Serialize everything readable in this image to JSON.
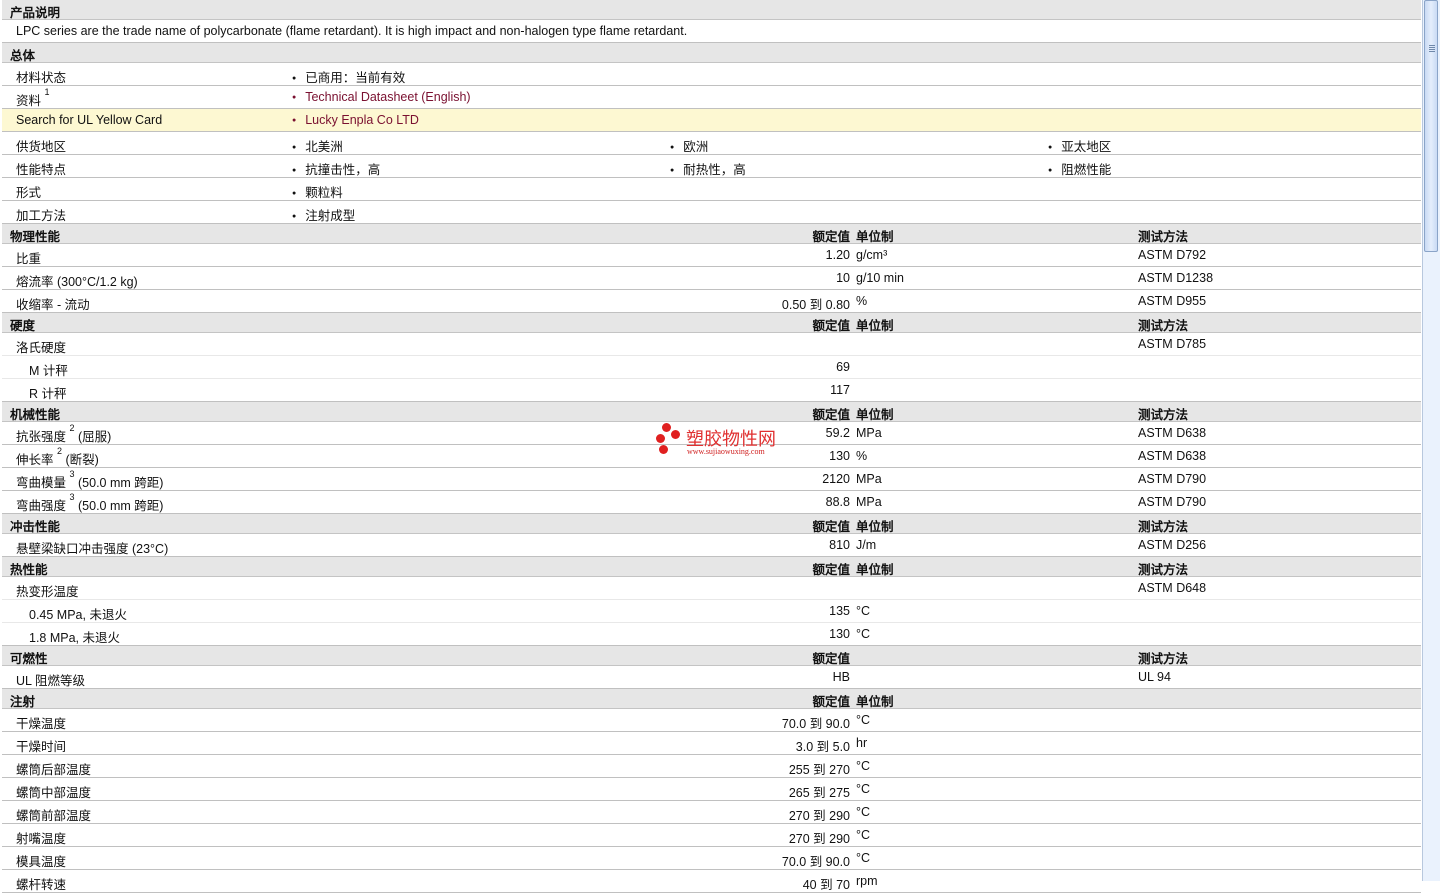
{
  "sections": [
    {
      "title": "产品说明",
      "rows": [
        {
          "type": "desc",
          "label": "LPC series are the trade name of polycarbonate (flame retardant). It is high impact and non-halogen type flame retardant."
        }
      ]
    },
    {
      "title": "总体",
      "rows": [
        {
          "type": "bullets",
          "label": "材料状态",
          "items": [
            "已商用：当前有效"
          ]
        },
        {
          "type": "bullets",
          "label": "资料",
          "sup": "1",
          "items": [
            "Technical Datasheet (English)"
          ],
          "link": true
        },
        {
          "type": "bullets",
          "label": "Search for UL Yellow Card",
          "items": [
            "Lucky Enpla Co LTD"
          ],
          "link": true,
          "yellow": true
        },
        {
          "type": "bullets",
          "label": "供货地区",
          "items": [
            "北美洲",
            "欧洲",
            "亚太地区"
          ]
        },
        {
          "type": "bullets",
          "label": "性能特点",
          "items": [
            "抗撞击性，高",
            "耐热性，高",
            "阻燃性能"
          ]
        },
        {
          "type": "bullets",
          "label": "形式",
          "items": [
            "颗粒料"
          ]
        },
        {
          "type": "bullets",
          "label": "加工方法",
          "items": [
            "注射成型"
          ]
        }
      ]
    },
    {
      "title": "物理性能",
      "h_val": "额定值",
      "h_unit": "单位制",
      "h_tm": "测试方法",
      "rows": [
        {
          "label": "比重",
          "value": "1.20",
          "unit": "g/cm³",
          "tm": "ASTM D792"
        },
        {
          "label": "熔流率  (300°C/1.2 kg)",
          "value": "10",
          "unit": "g/10 min",
          "tm": "ASTM D1238"
        },
        {
          "label": "收缩率  - 流动",
          "value": "0.50 到  0.80",
          "unit": "%",
          "tm": "ASTM D955"
        }
      ]
    },
    {
      "title": "硬度",
      "h_val": "额定值",
      "h_unit": "单位制",
      "h_tm": "测试方法",
      "rows": [
        {
          "label": "洛氏硬度",
          "tm": "ASTM D785",
          "sub": true
        },
        {
          "label": "M 计秤",
          "value": "69",
          "ind": true,
          "sub": true
        },
        {
          "label": "R 计秤",
          "value": "117",
          "ind": true
        }
      ]
    },
    {
      "title": "机械性能",
      "h_val": "额定值",
      "h_unit": "单位制",
      "h_tm": "测试方法",
      "rows": [
        {
          "label": "抗张强度",
          "sup": "2",
          "after": "(屈服)",
          "value": "59.2",
          "unit": "MPa",
          "tm": "ASTM D638"
        },
        {
          "label": "伸长率",
          "sup": "2",
          "after": "(断裂)",
          "value": "130",
          "unit": "%",
          "tm": "ASTM D638"
        },
        {
          "label": "弯曲模量",
          "sup": "3",
          "after": "(50.0 mm 跨距)",
          "value": "2120",
          "unit": "MPa",
          "tm": "ASTM D790"
        },
        {
          "label": "弯曲强度",
          "sup": "3",
          "after": "(50.0 mm 跨距)",
          "value": "88.8",
          "unit": "MPa",
          "tm": "ASTM D790"
        }
      ]
    },
    {
      "title": "冲击性能",
      "h_val": "额定值",
      "h_unit": "单位制",
      "h_tm": "测试方法",
      "rows": [
        {
          "label": "悬壁梁缺口冲击强度  (23°C)",
          "value": "810",
          "unit": "J/m",
          "tm": "ASTM D256"
        }
      ]
    },
    {
      "title": "热性能",
      "h_val": "额定值",
      "h_unit": "单位制",
      "h_tm": "测试方法",
      "rows": [
        {
          "label": "热变形温度",
          "tm": "ASTM D648",
          "sub": true
        },
        {
          "label": "0.45 MPa, 未退火",
          "value": "135",
          "unit": "°C",
          "ind": true,
          "sub": true
        },
        {
          "label": "1.8 MPa, 未退火",
          "value": "130",
          "unit": "°C",
          "ind": true
        }
      ]
    },
    {
      "title": "可燃性",
      "h_val": "额定值",
      "h_tm": "测试方法",
      "rows": [
        {
          "label": "UL 阻燃等级",
          "value": "HB",
          "tm": "UL 94"
        }
      ]
    },
    {
      "title": "注射",
      "h_val": "额定值",
      "h_unit": "单位制",
      "rows": [
        {
          "label": "干燥温度",
          "value": "70.0 到  90.0",
          "unit": "°C"
        },
        {
          "label": "干燥时间",
          "value": "3.0 到  5.0",
          "unit": "hr"
        },
        {
          "label": "螺筒后部温度",
          "value": "255 到  270",
          "unit": "°C"
        },
        {
          "label": "螺筒中部温度",
          "value": "265 到  275",
          "unit": "°C"
        },
        {
          "label": "螺筒前部温度",
          "value": "270 到  290",
          "unit": "°C"
        },
        {
          "label": "射嘴温度",
          "value": "270 到  290",
          "unit": "°C"
        },
        {
          "label": "模具温度",
          "value": "70.0 到  90.0",
          "unit": "°C"
        },
        {
          "label": "螺杆转速",
          "value": "40 到  70",
          "unit": "rpm"
        }
      ]
    }
  ],
  "watermark": {
    "title": "塑胶物性网",
    "url": "www.sujiaowuxing.com"
  }
}
